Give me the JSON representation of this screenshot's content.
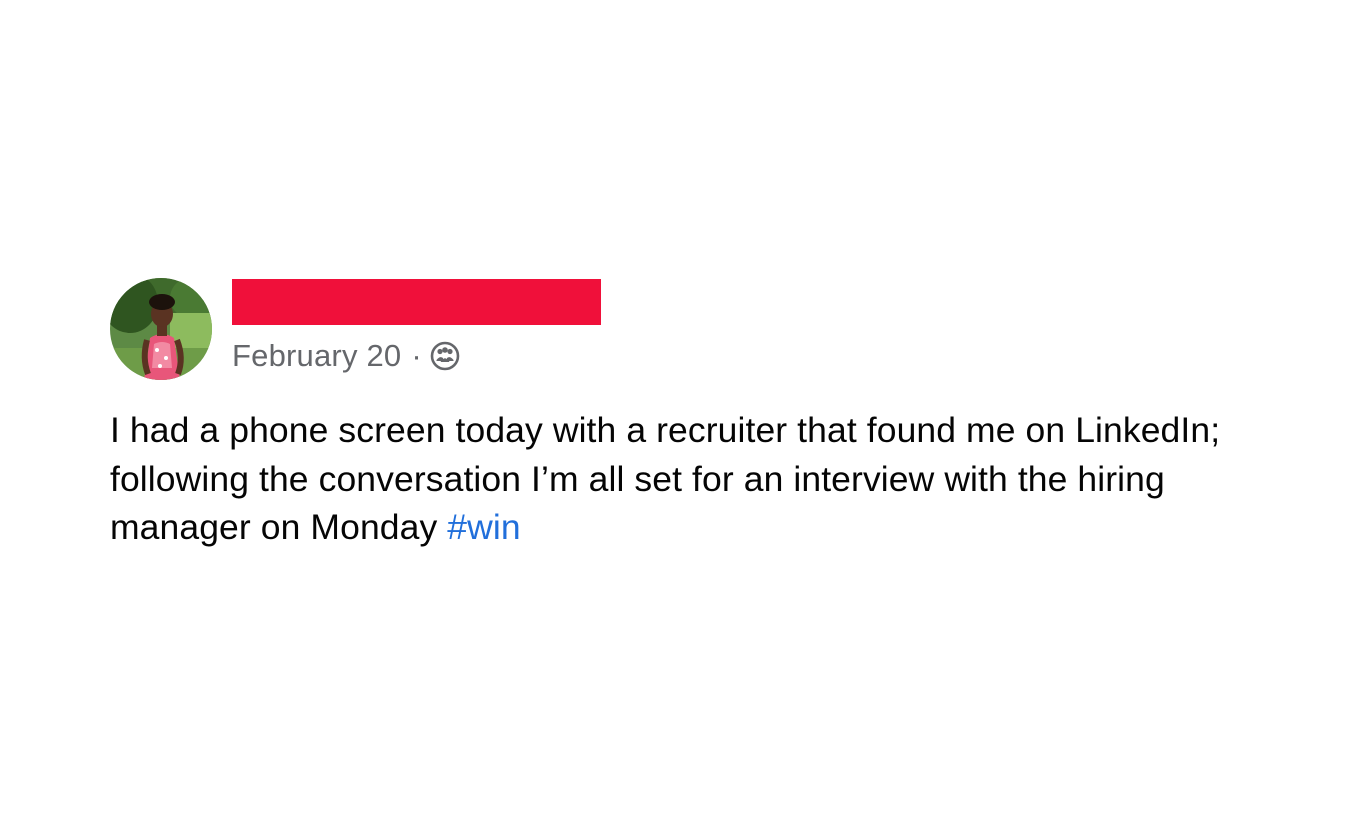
{
  "post": {
    "author": {
      "name_redacted": true,
      "redaction_color": "#f0103a",
      "avatar_icon": "profile-photo"
    },
    "timestamp": "February 20",
    "separator": "·",
    "audience_icon": "friends-icon",
    "text_plain": "I had a phone screen today with a recruiter that found me on LinkedIn; following the conversation I’m all set for an interview with the hiring manager on Monday",
    "hashtag": "#win",
    "colors": {
      "text": "#050505",
      "secondary_text": "#65676b",
      "link": "#216fdb"
    }
  }
}
